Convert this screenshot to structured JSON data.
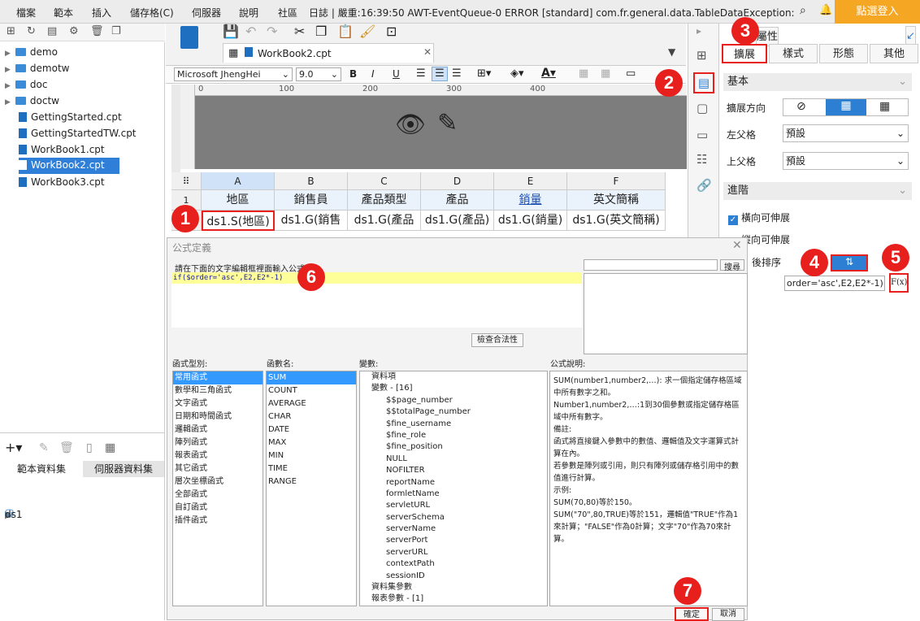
{
  "menu": {
    "items": [
      "檔案",
      "範本",
      "插入",
      "儲存格(C)",
      "伺服器",
      "說明",
      "社區"
    ],
    "log": "日誌 | 嚴重:16:39:50 AWT-EventQueue-0 ERROR [standard] com.fr.general.data.TableDataException: 錯誤代...",
    "login": "點選登入"
  },
  "tree": [
    "demo",
    "demotw",
    "doc",
    "doctw",
    "GettingStarted.cpt",
    "GettingStartedTW.cpt",
    "WorkBook1.cpt",
    "WorkBook2.cpt",
    "WorkBook3.cpt"
  ],
  "datasets": {
    "tab1": "範本資料集",
    "tab2": "伺服器資料集",
    "item": "ds1"
  },
  "editor": {
    "tab": "WorkBook2.cpt",
    "font": "Microsoft JhengHei",
    "size": "9.0"
  },
  "ruler": [
    "0",
    "100",
    "200",
    "300",
    "400"
  ],
  "grid": {
    "cols": [
      "A",
      "B",
      "C",
      "D",
      "E",
      "F"
    ],
    "row1": [
      "地區",
      "銷售員",
      "產品類型",
      "產品",
      "銷量",
      "英文簡稱"
    ],
    "row2": [
      "ds1.S(地區)",
      "ds1.G(銷售",
      "ds1.G(產品",
      "ds1.G(產品)",
      "ds1.G(銷量)",
      "ds1.G(英文簡稱)"
    ],
    "rownums": [
      "1",
      "2"
    ]
  },
  "right": {
    "title": "屬性",
    "tabs": [
      "擴展",
      "樣式",
      "形態",
      "其他"
    ],
    "basic": "基本",
    "dir": "擴展方向",
    "left_parent": "左父格",
    "top_parent": "上父格",
    "default": "預設",
    "adv": "進階",
    "hext": "橫向可伸展",
    "vext": "縱向可伸展",
    "sort": "後排序",
    "formula": "order='asc',E2,E2*-1)",
    "fx": "F(x)"
  },
  "dialog": {
    "title": "公式定義",
    "hint": "請在下面的文字編輯框裡面輸入公式",
    "formula": "if($order='asc',E2,E2*-1)",
    "search": "搜尋",
    "check": "檢查合法性",
    "h1": "函式型別:",
    "h2": "函數名:",
    "h3": "變數:",
    "h4": "公式說明:",
    "types": [
      "常用函式",
      "數學和三角函式",
      "文字函式",
      "日期和時間函式",
      "邏輯函式",
      "陣列函式",
      "報表函式",
      "其它函式",
      "層次坐標函式",
      "全部函式",
      "自訂函式",
      "插件函式"
    ],
    "funcs": [
      "SUM",
      "COUNT",
      "AVERAGE",
      "CHAR",
      "DATE",
      "MAX",
      "MIN",
      "TIME",
      "RANGE"
    ],
    "vars": [
      "資料項",
      "變數 - [16]",
      "$$page_number",
      "$$totalPage_number",
      "$fine_username",
      "$fine_role",
      "$fine_position",
      "NULL",
      "NOFILTER",
      "reportName",
      "formletName",
      "servletURL",
      "serverSchema",
      "serverName",
      "serverPort",
      "serverURL",
      "contextPath",
      "sessionID",
      "資料集參數",
      "報表參數 - [1]"
    ],
    "desc": [
      "SUM(number1,number2,…): 求一個指定儲存格區域中所有數字之和。",
      "Number1,number2,…:1到30個參數或指定儲存格區域中所有數字。",
      "備註:",
      "函式將直接鍵入參數中的數值、邏輯值及文字運算式計算在內。",
      "若參數是陣列或引用，則只有陣列或儲存格引用中的數值進行計算。",
      "示例:",
      "SUM(70,80)等於150。",
      "SUM(\"70\",80,TRUE)等於151，邏輯值\"TRUE\"作為1來計算；\"FALSE\"作為0計算；文字\"70\"作為70來計算。"
    ],
    "ok": "確定",
    "cancel": "取消"
  },
  "badges": [
    "1",
    "2",
    "3",
    "4",
    "5",
    "6",
    "7"
  ]
}
